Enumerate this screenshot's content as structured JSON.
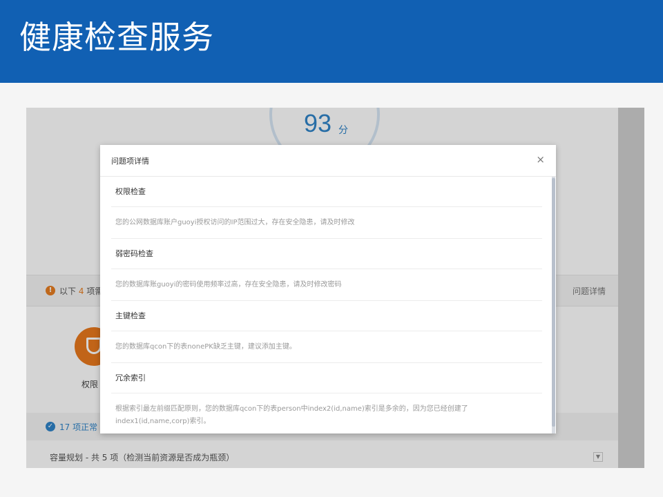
{
  "slide": {
    "title": "健康检查服务"
  },
  "app": {
    "score": "93",
    "score_unit": "分",
    "issues_prefix": "以下",
    "issues_count": "4",
    "issues_suffix": "项需",
    "issues_link": "问题详情",
    "shield_label": "权限",
    "normal_label": "17 项正常",
    "capacity_label": "容量规划 - 共 5 项（检测当前资源是否成为瓶颈）"
  },
  "modal": {
    "title": "问题项详情",
    "close_icon": "×",
    "items": [
      {
        "title": "权限检查",
        "desc": "您的公网数据库账户guoyi授权访问的IP范围过大，存在安全隐患，请及时修改"
      },
      {
        "title": "弱密码检查",
        "desc": "您的数据库账guoyi的密码使用频率过高，存在安全隐患，请及时修改密码"
      },
      {
        "title": "主键检查",
        "desc": "您的数据库qcon下的表nonePK缺乏主键，建议添加主键。"
      },
      {
        "title": "冗余索引",
        "desc": "根据索引最左前缀匹配原则，您的数据库qcon下的表person中index2(id,name)索引是多余的，因为您已经创建了index1(id,name,corp)索引。"
      }
    ]
  },
  "colors": {
    "header_blue": "#1160b3",
    "accent_blue": "#2f84c8",
    "warning_orange": "#e67e22"
  }
}
